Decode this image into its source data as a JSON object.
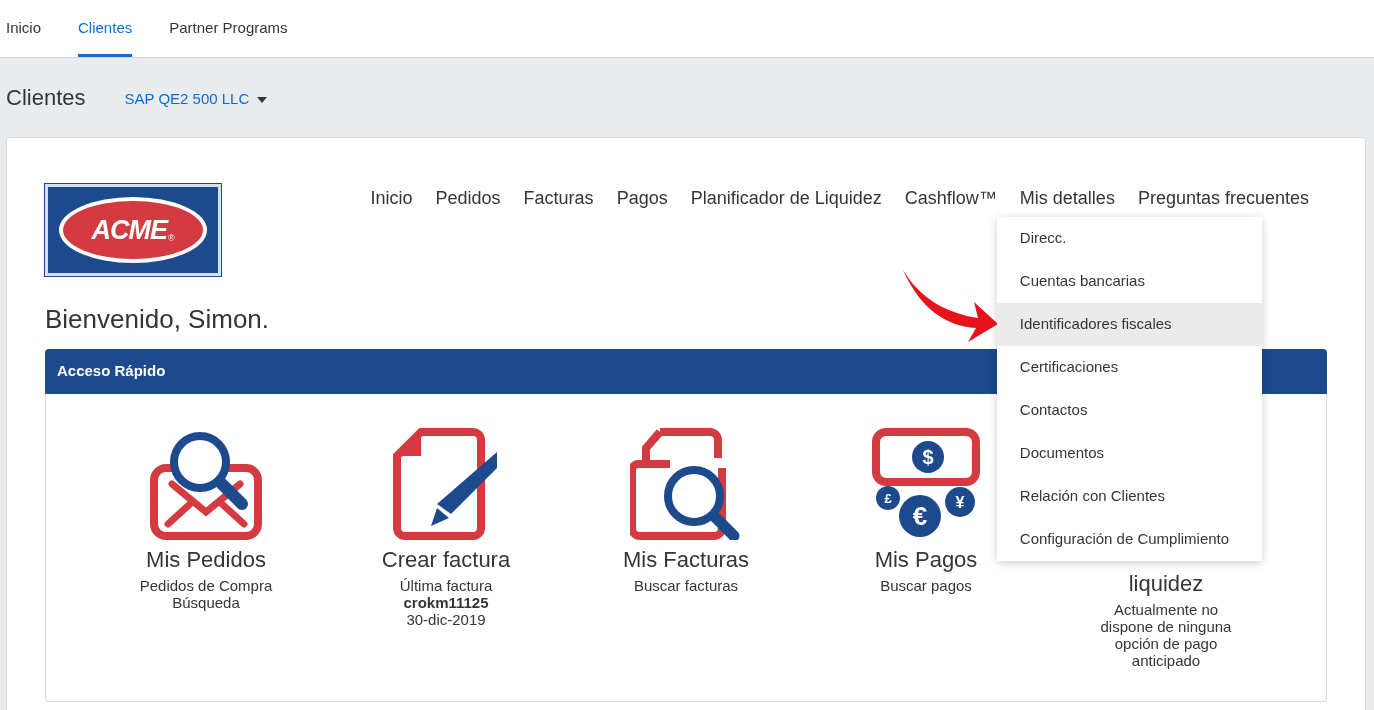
{
  "top_tabs": [
    {
      "label": "Inicio",
      "selected": false
    },
    {
      "label": "Clientes",
      "selected": true
    },
    {
      "label": "Partner Programs",
      "selected": false
    }
  ],
  "page_title": "Clientes",
  "account_selector": "SAP QE2 500 LLC",
  "logo": {
    "text": "ACME",
    "mark": "®"
  },
  "nav": [
    {
      "label": "Inicio"
    },
    {
      "label": "Pedidos"
    },
    {
      "label": "Facturas"
    },
    {
      "label": "Pagos"
    },
    {
      "label": "Planificador de Liquidez"
    },
    {
      "label": "Cashflow™"
    },
    {
      "label": "Mis detalles",
      "menu": [
        {
          "label": "Direcc.",
          "selected": false
        },
        {
          "label": "Cuentas bancarias",
          "selected": false
        },
        {
          "label": "Identificadores fiscales",
          "selected": true
        },
        {
          "label": "Certificaciones",
          "selected": false
        },
        {
          "label": "Contactos",
          "selected": false
        },
        {
          "label": "Documentos",
          "selected": false
        },
        {
          "label": "Relación con Clientes",
          "selected": false
        },
        {
          "label": "Configuración de Cumplimiento",
          "selected": false
        }
      ]
    },
    {
      "label": "Preguntas frecuentes"
    }
  ],
  "welcome": "Bienvenido, Simon.",
  "quick_access": {
    "title": "Acceso Rápido",
    "tiles": [
      {
        "kind": "orders",
        "title": "Mis Pedidos",
        "lines": [
          {
            "text": "Pedidos de Compra",
            "bold": false
          },
          {
            "text": "Búsqueda",
            "bold": false
          }
        ]
      },
      {
        "kind": "create_invoice",
        "title": "Crear factura",
        "lines": [
          {
            "text": "Última factura",
            "bold": false
          },
          {
            "text": "crokm11125",
            "bold": true
          },
          {
            "text": "30-dic-2019",
            "bold": false
          }
        ]
      },
      {
        "kind": "invoices",
        "title": "Mis Facturas",
        "lines": [
          {
            "text": "Buscar facturas",
            "bold": false
          }
        ]
      },
      {
        "kind": "payments",
        "title": "Mis Pagos",
        "symbols": [
          "$",
          "£",
          "€",
          "¥"
        ],
        "lines": [
          {
            "text": "Buscar pagos",
            "bold": false
          }
        ]
      },
      {
        "kind": "planner",
        "title": "liquidez",
        "lines": [
          {
            "text": "Actualmente no dispone de ninguna opción de pago anticipado",
            "bold": false
          }
        ]
      }
    ]
  },
  "annotation": {
    "kind": "arrow"
  }
}
